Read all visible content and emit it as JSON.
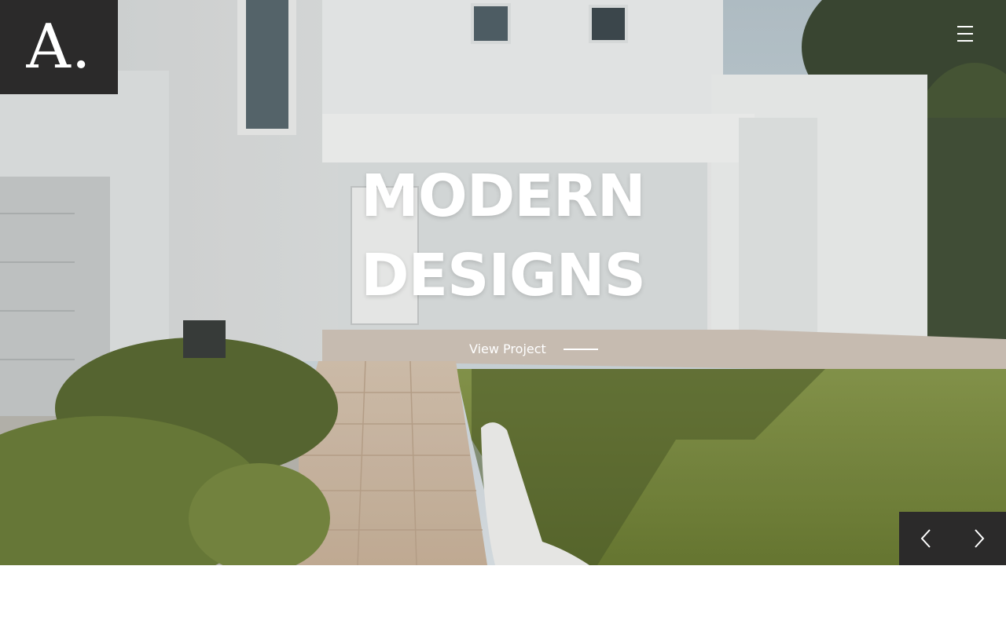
{
  "logo": {
    "text": "A."
  },
  "header": {
    "menu_icon": "hamburger-menu-icon"
  },
  "hero": {
    "title_line_1": "MODERN",
    "title_line_2": "DESIGNS",
    "cta_label": "View Project"
  },
  "slider": {
    "prev_icon": "chevron-left-icon",
    "next_icon": "chevron-right-icon"
  },
  "colors": {
    "dark_panel": "#2b2a2a",
    "text_light": "#ffffff"
  }
}
